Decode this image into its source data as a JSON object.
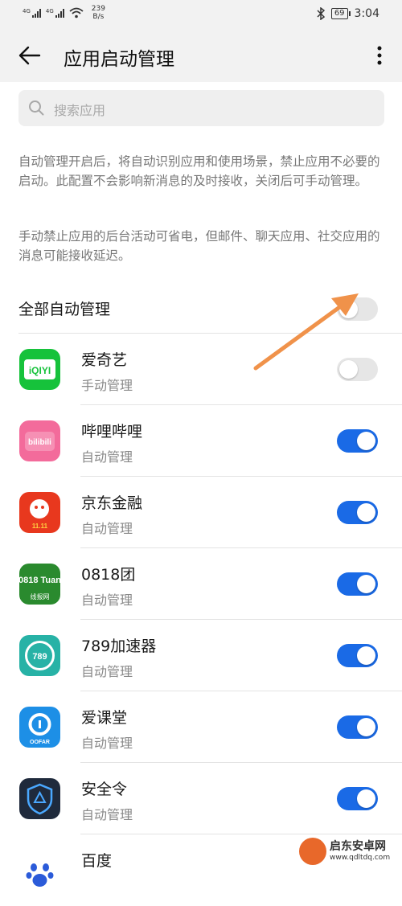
{
  "status_bar": {
    "sim1": "4G",
    "sim2": "4G",
    "speed_value": "239",
    "speed_unit": "B/s",
    "battery": "69",
    "time": "3:04"
  },
  "header": {
    "title": "应用启动管理"
  },
  "search": {
    "placeholder": "搜索应用"
  },
  "description": {
    "line1": "自动管理开启后，将自动识别应用和使用场景，禁止应用不必要的启动。此配置不会影响新消息的及时接收，关闭后可手动管理。",
    "line2": "手动禁止应用的后台活动可省电，但邮件、聊天应用、社交应用的消息可能接收延迟。"
  },
  "all_auto": {
    "label": "全部自动管理",
    "enabled": false
  },
  "apps": [
    {
      "name": "爱奇艺",
      "status": "手动管理",
      "enabled": false,
      "icon": "iqiyi-icon",
      "icon_text": "iQIYI"
    },
    {
      "name": "哔哩哔哩",
      "status": "自动管理",
      "enabled": true,
      "icon": "bilibili-icon",
      "icon_text": "bilibili"
    },
    {
      "name": "京东金融",
      "status": "自动管理",
      "enabled": true,
      "icon": "jd-finance-icon",
      "icon_text": "11.11"
    },
    {
      "name": "0818团",
      "status": "自动管理",
      "enabled": true,
      "icon": "0818tuan-icon",
      "icon_text": "0818 Tuan",
      "icon_sub": "线报网"
    },
    {
      "name": "789加速器",
      "status": "自动管理",
      "enabled": true,
      "icon": "789-accelerator-icon",
      "icon_text": "789"
    },
    {
      "name": "爱课堂",
      "status": "自动管理",
      "enabled": true,
      "icon": "aiketang-icon",
      "icon_text": "OOFAR"
    },
    {
      "name": "安全令",
      "status": "自动管理",
      "enabled": true,
      "icon": "security-token-icon"
    },
    {
      "name": "百度",
      "status": "",
      "enabled": true,
      "icon": "baidu-paw-icon"
    }
  ],
  "watermark": {
    "title": "启东安卓网",
    "url": "www.qdltdq.com"
  },
  "colors": {
    "accent": "#1a6ae6",
    "arrow": "#f0924a"
  }
}
